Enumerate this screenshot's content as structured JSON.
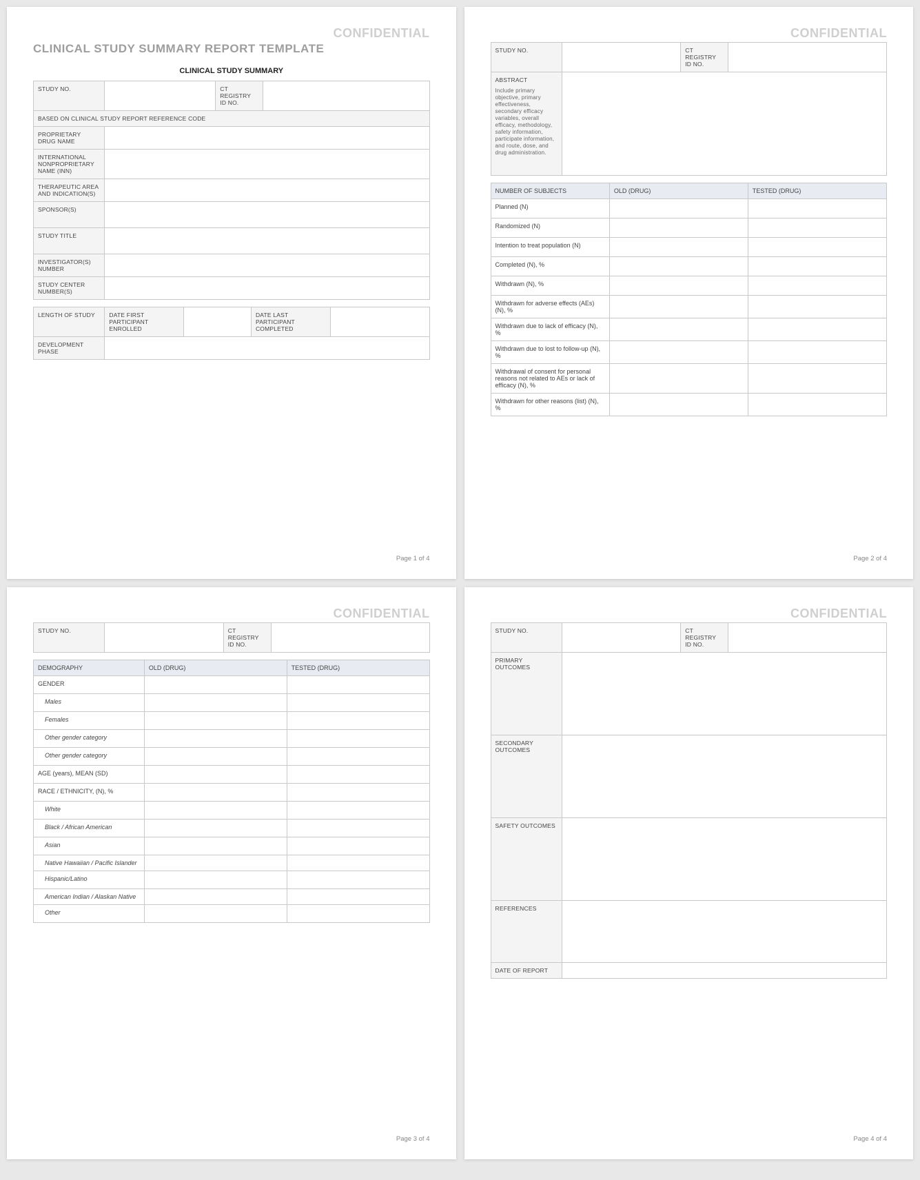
{
  "confidential": "CONFIDENTIAL",
  "doc_title": "CLINICAL STUDY SUMMARY REPORT TEMPLATE",
  "section_heading": "CLINICAL STUDY SUMMARY",
  "footer": {
    "p1": "Page 1 of 4",
    "p2": "Page 2 of 4",
    "p3": "Page 3 of 4",
    "p4": "Page 4 of 4"
  },
  "p1": {
    "study_no": "STUDY NO.",
    "ct_registry": "CT REGISTRY ID NO.",
    "based_on": "BASED ON CLINICAL STUDY REPORT REFERENCE CODE",
    "proprietary": "PROPRIETARY DRUG NAME",
    "inn": "INTERNATIONAL NONPROPRIETARY NAME (INN)",
    "therapeutic": "THERAPEUTIC AREA AND INDICATION(S)",
    "sponsor": "SPONSOR(S)",
    "study_title": "STUDY TITLE",
    "investigator": "INVESTIGATOR(S) NUMBER",
    "center": "STUDY CENTER NUMBER(S)",
    "length": "LENGTH OF STUDY",
    "date_first": "DATE FIRST PARTICIPANT ENROLLED",
    "date_last": "DATE LAST PARTICIPANT COMPLETED",
    "dev_phase": "DEVELOPMENT PHASE"
  },
  "p2": {
    "study_no": "STUDY NO.",
    "ct_registry": "CT REGISTRY ID NO.",
    "abstract": "ABSTRACT",
    "abstract_note": "Include primary objective, primary effectiveness, secondary efficacy variables, overall efficacy, methodology, safety information, participate information, and route, dose, and drug administration.",
    "subjects_header": "NUMBER OF SUBJECTS",
    "old_drug": "OLD (DRUG)",
    "tested_drug": "TESTED (DRUG)",
    "rows": {
      "planned": "Planned (N)",
      "randomized": "Randomized (N)",
      "itt": "Intention to treat population (N)",
      "completed": "Completed (N), %",
      "withdrawn": "Withdrawn (N), %",
      "withdrawn_ae": "Withdrawn for adverse effects (AEs) (N), %",
      "withdrawn_efficacy": "Withdrawn due to lack of efficacy (N), %",
      "withdrawn_lost": "Withdrawn due to lost to follow-up (N), %",
      "withdrawn_consent": "Withdrawal of consent for personal reasons not related to AEs or lack of efficacy (N), %",
      "withdrawn_other": "Withdrawn for other reasons (list) (N), %"
    }
  },
  "p3": {
    "study_no": "STUDY NO.",
    "ct_registry": "CT REGISTRY ID NO.",
    "demo_header": "DEMOGRAPHY",
    "old_drug": "OLD (DRUG)",
    "tested_drug": "TESTED (DRUG)",
    "rows": {
      "gender": "GENDER",
      "males": "Males",
      "females": "Females",
      "other1": "Other gender category",
      "other2": "Other gender category",
      "age": "AGE (years), MEAN (SD)",
      "race": "RACE / ETHNICITY, (N), %",
      "white": "White",
      "black": "Black / African American",
      "asian": "Asian",
      "native_hawaiian": "Native Hawaiian / Pacific Islander",
      "hispanic": "Hispanic/Latino",
      "american_indian": "American Indian / Alaskan Native",
      "other": "Other"
    }
  },
  "p4": {
    "study_no": "STUDY NO.",
    "ct_registry": "CT REGISTRY ID NO.",
    "primary": "PRIMARY OUTCOMES",
    "secondary": "SECONDARY OUTCOMES",
    "safety": "SAFETY OUTCOMES",
    "references": "REFERENCES",
    "date_of_report": "DATE OF REPORT"
  }
}
